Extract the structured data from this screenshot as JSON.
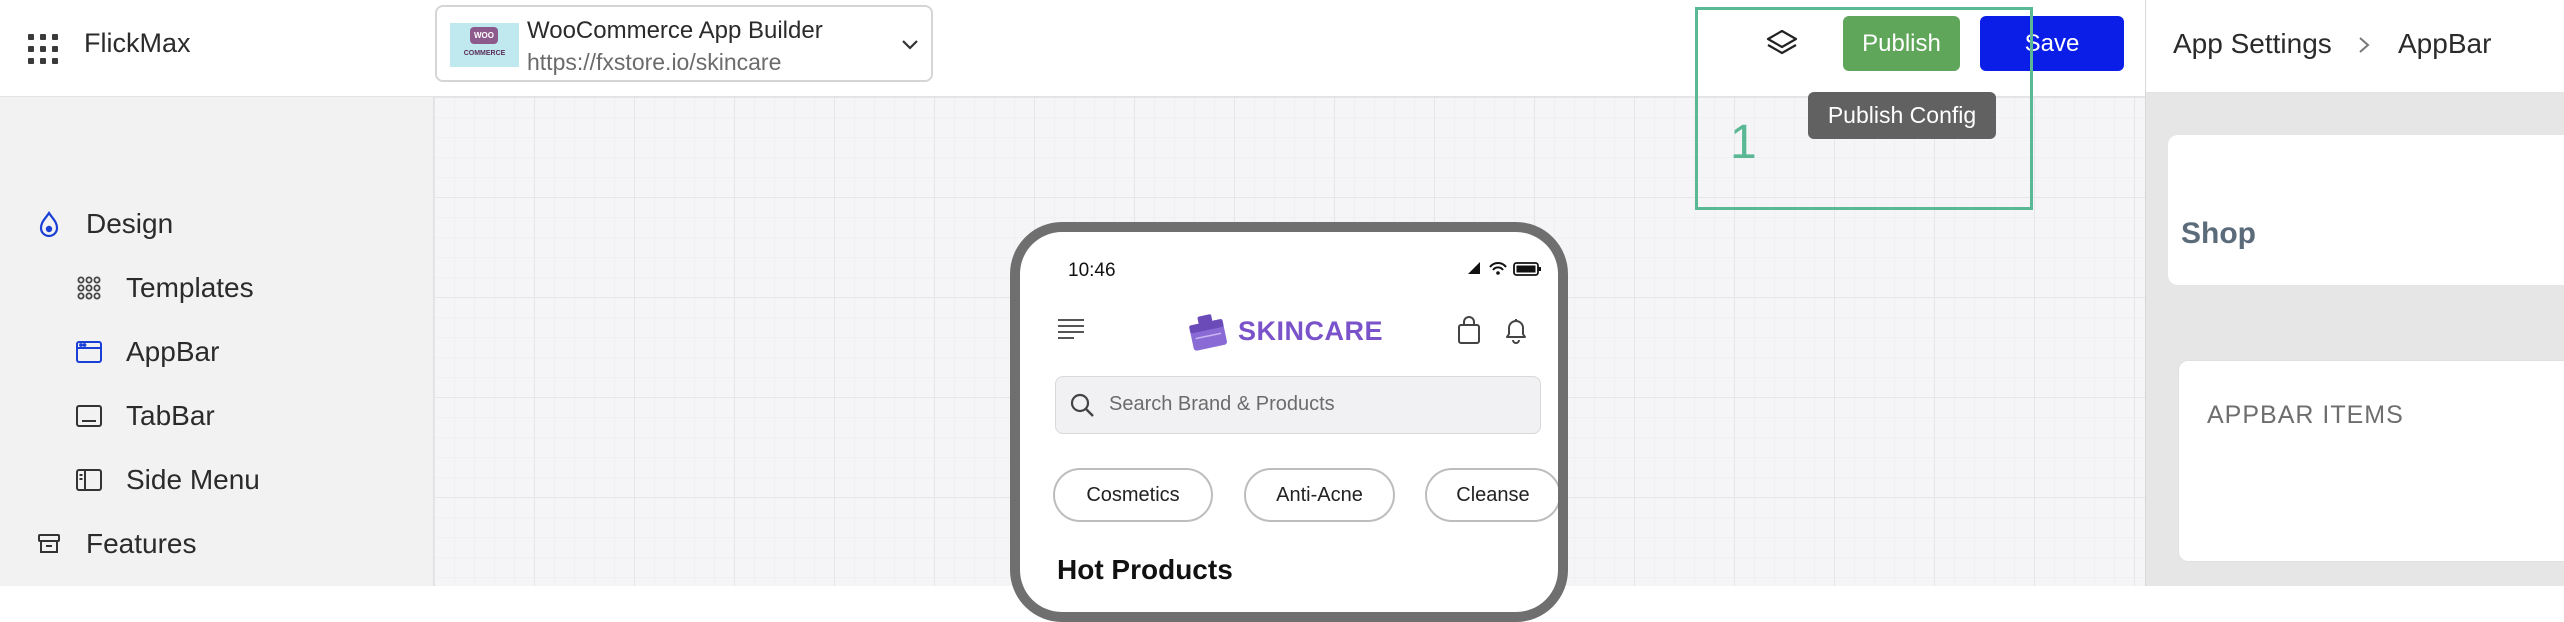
{
  "app": {
    "brand": "FlickMax"
  },
  "store": {
    "title": "WooCommerce App Builder",
    "url": "https://fxstore.io/skincare",
    "logo_text": "WOO",
    "logo_subtext": "COMMERCE"
  },
  "toolbar": {
    "publish_label": "Publish",
    "save_label": "Save",
    "tooltip": "Publish Config"
  },
  "annotation": {
    "label": "1",
    "color": "#5ab894"
  },
  "sidebar": {
    "items": [
      {
        "label": "Design",
        "icon": "design-icon"
      },
      {
        "label": "Templates",
        "icon": "templates-icon"
      },
      {
        "label": "AppBar",
        "icon": "appbar-icon"
      },
      {
        "label": "TabBar",
        "icon": "tabbar-icon"
      },
      {
        "label": "Side Menu",
        "icon": "side-menu-icon"
      },
      {
        "label": "Features",
        "icon": "features-icon"
      }
    ]
  },
  "breadcrumb": {
    "parent": "App Settings",
    "current": "AppBar"
  },
  "panel": {
    "shop_title": "Shop",
    "appbar_items_title": "APPBAR ITEMS"
  },
  "phone": {
    "time": "10:46",
    "logo_text": "SKINCARE",
    "search_placeholder": "Search Brand & Products",
    "chips": [
      "Cosmetics",
      "Anti-Acne",
      "Cleanse"
    ],
    "section_title": "Hot Products"
  },
  "colors": {
    "publish": "#5fa55a",
    "save": "#0a1ee8",
    "logo": "#7a52c9",
    "design_icon": "#1a3fd6"
  }
}
